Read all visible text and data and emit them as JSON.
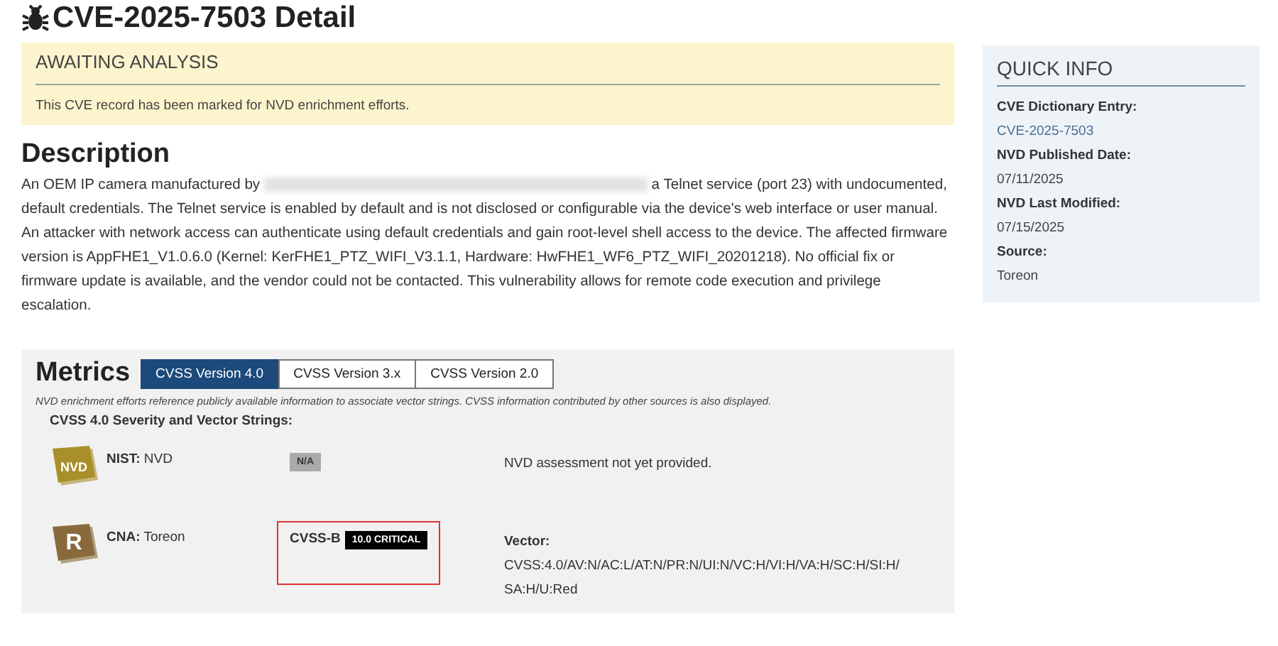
{
  "title": "CVE-2025-7503 Detail",
  "status": {
    "heading": "AWAITING ANALYSIS",
    "text": "This CVE record has been marked for NVD enrichment efforts."
  },
  "description": {
    "heading": "Description",
    "before": "An OEM IP camera manufactured by",
    "redacted": true,
    "after": "a Telnet service (port 23) with undocumented, default credentials. The Telnet service is enabled by default and is not disclosed or configurable via the device's web interface or user manual. An attacker with network access can authenticate using default credentials and gain root-level shell access to the device. The affected firmware version is AppFHE1_V1.0.6.0 (Kernel: KerFHE1_PTZ_WIFI_V3.1.1, Hardware: HwFHE1_WF6_PTZ_WIFI_20201218). No official fix or firmware update is available, and the vendor could not be contacted. This vulnerability allows for remote code execution and privilege escalation."
  },
  "metrics": {
    "heading": "Metrics",
    "tabs": [
      {
        "label": "CVSS Version 4.0",
        "selected": true
      },
      {
        "label": "CVSS Version 3.x",
        "selected": false
      },
      {
        "label": "CVSS Version 2.0",
        "selected": false
      }
    ],
    "note": "NVD enrichment efforts reference publicly available information to associate vector strings. CVSS information contributed by other sources is also displayed.",
    "subheading": "CVSS 4.0 Severity and Vector Strings:",
    "rows": [
      {
        "kind": "nist",
        "badge": "NVD",
        "source": "**NIST:** NVD",
        "score": {
          "kind": "na",
          "label": "N/A",
          "highlighted": false
        },
        "note": "NVD assessment not yet provided."
      },
      {
        "kind": "cna",
        "badge": "R",
        "source": "**CNA:**  Toreon",
        "score": {
          "kind": "critical",
          "prefix": "CVSS-B",
          "label": "10.0 CRITICAL",
          "highlighted": true
        },
        "vector_label": "Vector:",
        "vector": "CVSS:4.0/AV:N/AC:L/AT:N/PR:N/UI:N/VC:H/VI:H/VA:H/SC:H/SI:H/SA:H/U:Red"
      }
    ]
  },
  "quick_info": {
    "heading": "QUICK INFO",
    "items": [
      {
        "label": "CVE Dictionary Entry:",
        "value": "CVE-2025-7503",
        "kind": "link"
      },
      {
        "label": "NVD Published Date:",
        "value": "07/11/2025",
        "kind": "text"
      },
      {
        "label": "NVD Last Modified:",
        "value": "07/15/2025",
        "kind": "text"
      },
      {
        "label": "Source:",
        "value": "Toreon",
        "kind": "text"
      }
    ]
  }
}
